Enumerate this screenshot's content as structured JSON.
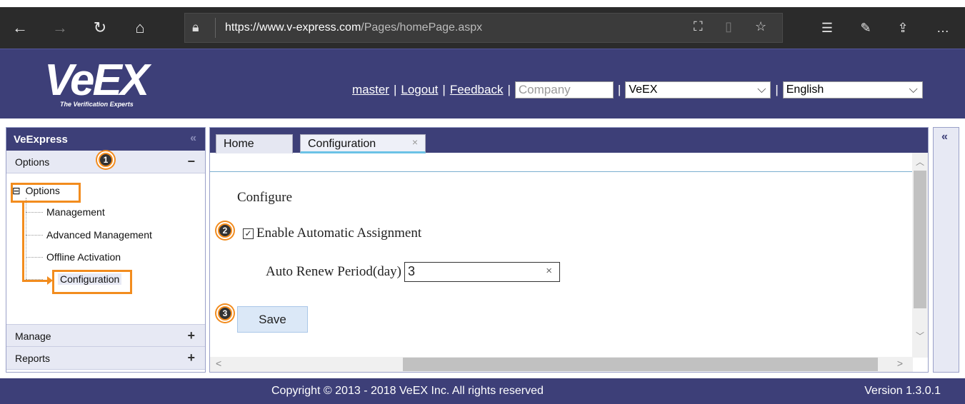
{
  "browser": {
    "url_host": "https://www.v-express.com",
    "url_path": "/Pages/homePage.aspx",
    "icons": [
      "back-icon",
      "forward-icon",
      "refresh-icon",
      "home-icon",
      "lock-icon",
      "translate-icon",
      "reading-view-icon",
      "favorite-star-icon",
      "favorites-list-icon",
      "pen-icon",
      "share-icon",
      "more-icon"
    ]
  },
  "header": {
    "logo_text": "VeEX",
    "logo_tagline": "The Verification Experts",
    "user_link": "master",
    "logout_link": "Logout",
    "feedback_link": "Feedback",
    "company_placeholder": "Company",
    "company_select": "VeEX",
    "language_select": "English",
    "separator": "|"
  },
  "sidebar": {
    "title": "VeExpress",
    "sections": [
      {
        "label": "Options",
        "symbol": "−"
      },
      {
        "label": "Manage",
        "symbol": "+"
      },
      {
        "label": "Reports",
        "symbol": "+"
      }
    ],
    "tree": {
      "root": "Options",
      "root_toggle": "⊟",
      "children": [
        "Management",
        "Advanced Management",
        "Offline Activation",
        "Configuration"
      ]
    }
  },
  "tabs": [
    {
      "label": "Home"
    },
    {
      "label": "Configuration",
      "close": "×"
    }
  ],
  "form": {
    "heading": "Configure",
    "checkbox_label": "Enable Automatic Assignment",
    "checkbox_checked": true,
    "renew_label": "Auto Renew Period(day)",
    "renew_value": "3",
    "clear_symbol": "×",
    "save_label": "Save"
  },
  "footer": {
    "copyright": "Copyright © 2013 - 2018 VeEX Inc. All rights reserved",
    "version": "Version 1.3.0.1"
  },
  "annotations": [
    "1",
    "2",
    "3"
  ],
  "colors": {
    "accent": "#f28c1e",
    "brand": "#3d3f78"
  }
}
